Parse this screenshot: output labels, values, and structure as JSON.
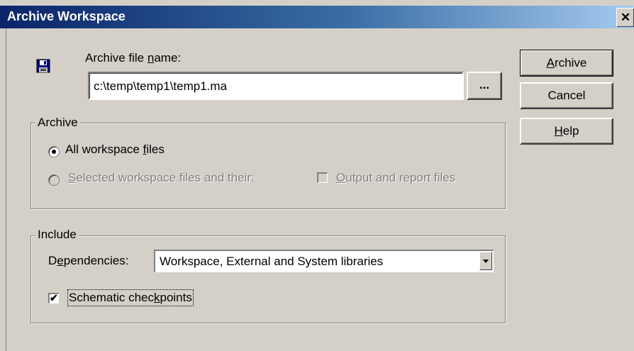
{
  "window": {
    "title": "Archive Workspace",
    "close_glyph": "✕"
  },
  "archive_file": {
    "label_pre": "Archive file ",
    "label_ul": "n",
    "label_post": "ame:",
    "value": "c:\\temp\\temp1\\temp1.ma",
    "browse_label": "...",
    "icon": "floppy-disk-icon"
  },
  "buttons": {
    "archive_ul": "A",
    "archive_post": "rchive",
    "cancel": "Cancel",
    "help_ul": "H",
    "help_post": "elp"
  },
  "archive_group": {
    "title": "Archive",
    "all_pre": "All workspace ",
    "all_ul": "f",
    "all_post": "iles",
    "selected_ul": "S",
    "selected_post": "elected workspace files and their:",
    "output_ul": "O",
    "output_post": "utput and report files",
    "all_selected": true,
    "output_checked": false
  },
  "include_group": {
    "title": "Include",
    "dependencies_pre": "D",
    "dependencies_ul": "e",
    "dependencies_post": "pendencies:",
    "dependencies_value": "Workspace, External and System libraries",
    "schematic_pre": "Schematic chec",
    "schematic_ul": "k",
    "schematic_post": "points",
    "schematic_checked": true
  },
  "colors": {
    "face": "#d4d0c8",
    "title_start": "#0a246a",
    "title_end": "#a6caf0",
    "disabled_text": "#808080"
  }
}
